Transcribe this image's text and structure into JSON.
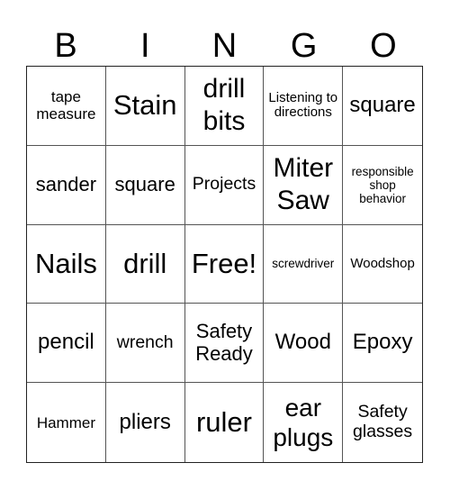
{
  "header": [
    "B",
    "I",
    "N",
    "G",
    "O"
  ],
  "cells": [
    "tape measure",
    "Stain",
    "drill bits",
    "Listening to directions",
    "square",
    "sander",
    "square",
    "Projects",
    "Miter Saw",
    "responsible shop behavior",
    "Nails",
    "drill",
    "Free!",
    "screwdriver",
    "Woodshop",
    "pencil",
    "wrench",
    "Safety Ready",
    "Wood",
    "Epoxy",
    "Hammer",
    "pliers",
    "ruler",
    "ear plugs",
    "Safety glasses"
  ]
}
